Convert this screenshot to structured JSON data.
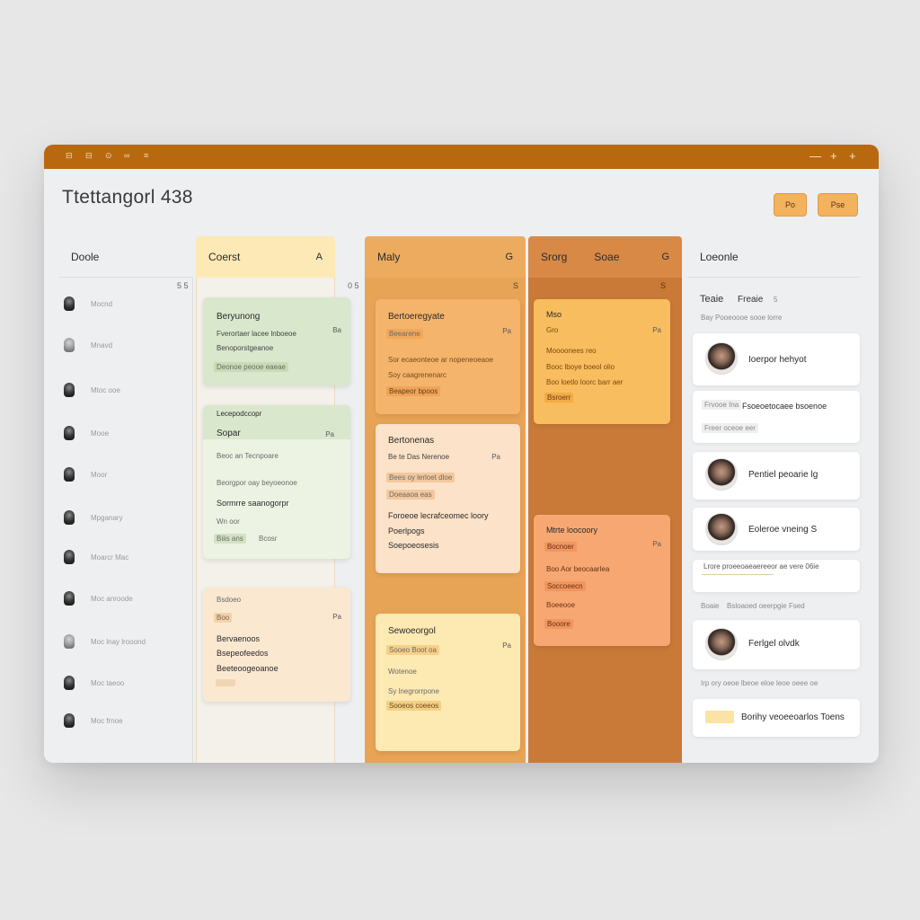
{
  "window": {
    "title_icons": [
      "grid-icon",
      "list-icon",
      "chat-icon",
      "link-icon",
      "menu-icon"
    ],
    "controls": [
      "—",
      "+",
      "+"
    ]
  },
  "header": {
    "title": "Ttettangorl 438",
    "btn1": "Po",
    "btn2": "Pse"
  },
  "colors": {
    "titlebar": "#b8690f",
    "accent": "#f2b25e",
    "green_card": "#d9e7cc",
    "yellow_col": "#fde9b6",
    "orange_col": "#e8a456",
    "dark_orange_col": "#c97a38"
  },
  "columns": [
    {
      "title": "Doole",
      "count": "",
      "meta": "5 5",
      "rows": [
        {
          "label": "Mocnd",
          "avatar": "dark"
        },
        {
          "label": "Mnavd",
          "avatar": "light"
        },
        {
          "label": "Mtoc ooe",
          "avatar": "dark"
        },
        {
          "label": "Mooe",
          "avatar": "dark"
        },
        {
          "label": "Moor",
          "avatar": "dark"
        },
        {
          "label": "Mpganary",
          "avatar": "dark"
        },
        {
          "label": "Moarcr Mac",
          "avatar": "dark"
        },
        {
          "label": "Moc anroode",
          "avatar": "dark"
        },
        {
          "label": "Moc lnay lrooond",
          "avatar": "light"
        },
        {
          "label": "Moc taeoo",
          "avatar": "dark"
        },
        {
          "label": "Moc frnoe",
          "avatar": "dark"
        }
      ]
    },
    {
      "title": "Coerst",
      "count": "A",
      "meta": "0 5",
      "cards": [
        {
          "title": "Beryunong",
          "line1": "Fverortaer lacee lnboeoe",
          "line2": "Benoporstgeanoe",
          "tag": "Deonoe peooe eaeae",
          "pill": "Ba"
        },
        {
          "title": "Lecepodccopr",
          "sub": "Sopar",
          "pill": "Pa",
          "line1": "Beoc an Tecnpoare",
          "line2": "Beorgpor oay beyoeonoe",
          "line3": "Sormrre saanogorpr",
          "line4": "Wn oor",
          "tag": "Biiis ans",
          "tag2": "Bcosr"
        },
        {
          "title": "Bsdoeo",
          "sub": "Boo",
          "pill": "Pa",
          "line1": "Bervaenoos",
          "line2": "Bsepeofeedos",
          "line3": "Beeteoogeoanoe"
        }
      ]
    },
    {
      "title": "Maly",
      "count": "G",
      "meta": "S",
      "cards": [
        {
          "title": "Bertoeregyate",
          "sub": "Beearene",
          "pill": "Pa",
          "line1": "Sor ecaeonteoe ar nopeneoeaoe",
          "line2": "Soy caagrenenarc",
          "tag": "Beapeor bpoos"
        },
        {
          "title": "Bertonenas",
          "sub": "Be te Das Nerenoe",
          "pill": "Pa",
          "line1": "Bees oy lerloet dloe",
          "line2": "Doeaaoa eas",
          "line3": "Foroeoe lecrafceomec loory",
          "line4": "Poerlpogs",
          "line5": "Soepoeosesis"
        },
        {
          "title": "Sewoeorgol",
          "sub": "Sooeo Boot oa",
          "pill": "Pa",
          "line1": "Wotenoe",
          "line2": "Sy lnegrorrpone",
          "tag": "Sooeos coeeos"
        }
      ]
    },
    {
      "title": "Srorg",
      "extra": "Soae",
      "count": "G",
      "meta": "S",
      "cards": [
        {
          "title": "Mso",
          "sub": "Gro",
          "pill": "Pa",
          "line1": "Moooonees reo",
          "line2": "Booc lboye boeol olio",
          "line3": "Boo loetlo loorc barr aer",
          "tag": "Bsroerr"
        },
        {
          "title": "Mtrte loocoory",
          "sub": "Bocnoer",
          "pill": "Pa",
          "line1": "Boo Aor beocaarlea",
          "line2": "Soccoeecn",
          "line3": "Boeeooe",
          "line4": "Booore"
        }
      ]
    }
  ],
  "right_panel": {
    "title": "Loeonle",
    "sub_title": "Teaie",
    "sub_title2": "Freaie",
    "sub_count": "5",
    "sub_meta": "Bay Pooeoooe sooe lorre",
    "people": [
      {
        "name": "Ioerpor hehyot"
      },
      {
        "name": "Frvooe Ina",
        "line": "Fsoeoetocaee bsoenoe",
        "line2": "Freer oceoe eer"
      },
      {
        "name": "Pentiel peoarie lg"
      },
      {
        "name": "Eoleroe vneing S"
      },
      {
        "line": "Lrore proeeoaeaereeor ae vere 06ie"
      }
    ],
    "meta2_a": "Boaie",
    "meta2_b": "Bsloaoed oeerpgie Fsed",
    "person6": "Ferlgel olvdk",
    "footer_meta": "Irp ory oeoe lbeoe eloe leoe oeee oe",
    "footer_label": "Borihy veoeeoarlos Toens"
  }
}
